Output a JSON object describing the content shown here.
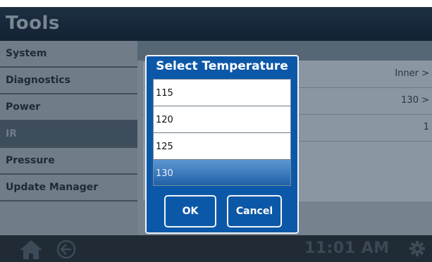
{
  "header": {
    "title": "Tools"
  },
  "sidebar": {
    "items": [
      {
        "label": "System"
      },
      {
        "label": "Diagnostics"
      },
      {
        "label": "Power"
      },
      {
        "label": "IR"
      },
      {
        "label": "Pressure"
      },
      {
        "label": "Update Manager"
      }
    ],
    "active_index": 3
  },
  "content": {
    "rows": [
      {
        "value": "Inner >"
      },
      {
        "value": "130 >"
      },
      {
        "value": "1"
      }
    ]
  },
  "dialog": {
    "title": "Select Temperature",
    "options": [
      "115",
      "120",
      "125",
      "130"
    ],
    "selected": "130",
    "ok_label": "OK",
    "cancel_label": "Cancel"
  },
  "footer": {
    "time": "11:01 AM",
    "icons": [
      "home-icon",
      "back-icon",
      "gear-icon"
    ]
  },
  "colors": {
    "dialog_blue": "#0c58a8",
    "selection_blue": "#1d5ea6",
    "header_bg": "#1c2f42"
  }
}
